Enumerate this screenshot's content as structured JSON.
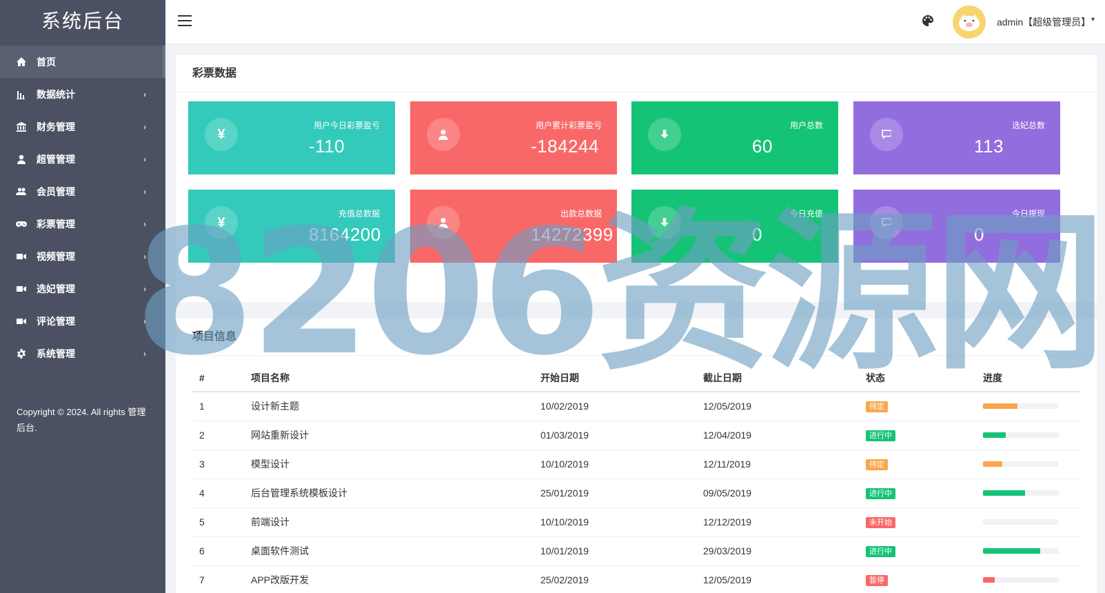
{
  "sidebar": {
    "brand": "系统后台",
    "items": [
      {
        "label": "首页",
        "icon": "home-icon",
        "has_children": false,
        "active": true
      },
      {
        "label": "数据统计",
        "icon": "bar-chart-icon",
        "has_children": true
      },
      {
        "label": "财务管理",
        "icon": "bank-icon",
        "has_children": true
      },
      {
        "label": "超管管理",
        "icon": "user-icon",
        "has_children": true
      },
      {
        "label": "会员管理",
        "icon": "users-icon",
        "has_children": true
      },
      {
        "label": "彩票管理",
        "icon": "gamepad-icon",
        "has_children": true
      },
      {
        "label": "视频管理",
        "icon": "video-camera-icon",
        "has_children": true
      },
      {
        "label": "选妃管理",
        "icon": "video-camera-icon",
        "has_children": true
      },
      {
        "label": "评论管理",
        "icon": "video-camera-icon",
        "has_children": true
      },
      {
        "label": "系统管理",
        "icon": "gear-icon",
        "has_children": true
      }
    ],
    "chevron": "›",
    "copyright": "Copyright © 2024. All rights 管理后台."
  },
  "header": {
    "user": "admin【超级管理员】",
    "caret": "▾"
  },
  "lottery_panel": {
    "title": "彩票数据",
    "cards": [
      {
        "label": "用户今日彩票盈亏",
        "value": "-110",
        "icon": "yen-icon",
        "color": "teal"
      },
      {
        "label": "用户累计彩票盈亏",
        "value": "-184244",
        "icon": "user-icon",
        "color": "red"
      },
      {
        "label": "用户总数",
        "value": "60",
        "icon": "download-icon",
        "color": "green"
      },
      {
        "label": "选妃总数",
        "value": "113",
        "icon": "comment-icon",
        "color": "purple"
      },
      {
        "label": "充值总数据",
        "value": "8164200",
        "icon": "yen-icon",
        "color": "teal"
      },
      {
        "label": "出款总数据",
        "value": "14272399",
        "icon": "user-icon",
        "color": "red"
      },
      {
        "label": "今日充值",
        "value": "0",
        "icon": "download-icon",
        "color": "green"
      },
      {
        "label": "今日提现",
        "value": "0",
        "icon": "comment-icon",
        "color": "purple"
      }
    ],
    "yen_symbol": "¥"
  },
  "project_panel": {
    "title": "项目信息",
    "columns": [
      "#",
      "项目名称",
      "开始日期",
      "截止日期",
      "状态",
      "进度"
    ],
    "rows": [
      {
        "id": "1",
        "name": "设计新主题",
        "start": "10/02/2019",
        "end": "12/05/2019",
        "status": "待定",
        "status_type": "warning",
        "progress": 45
      },
      {
        "id": "2",
        "name": "网站重新设计",
        "start": "01/03/2019",
        "end": "12/04/2019",
        "status": "进行中",
        "status_type": "success",
        "progress": 30
      },
      {
        "id": "3",
        "name": "模型设计",
        "start": "10/10/2019",
        "end": "12/11/2019",
        "status": "待定",
        "status_type": "warning",
        "progress": 25
      },
      {
        "id": "4",
        "name": "后台管理系统模板设计",
        "start": "25/01/2019",
        "end": "09/05/2019",
        "status": "进行中",
        "status_type": "success",
        "progress": 55
      },
      {
        "id": "5",
        "name": "前端设计",
        "start": "10/10/2019",
        "end": "12/12/2019",
        "status": "未开始",
        "status_type": "danger",
        "progress": 0
      },
      {
        "id": "6",
        "name": "桌面软件测试",
        "start": "10/01/2019",
        "end": "29/03/2019",
        "status": "进行中",
        "status_type": "success",
        "progress": 75
      },
      {
        "id": "7",
        "name": "APP改版开发",
        "start": "25/02/2019",
        "end": "12/05/2019",
        "status": "暂停",
        "status_type": "danger",
        "progress": 15
      }
    ]
  },
  "watermark": "8206资源网",
  "colors": {
    "sidebar": "#4b5162",
    "teal": "#33cabb",
    "red": "#f96868",
    "green": "#15c377",
    "purple": "#926dde",
    "warning": "#faa64b"
  }
}
